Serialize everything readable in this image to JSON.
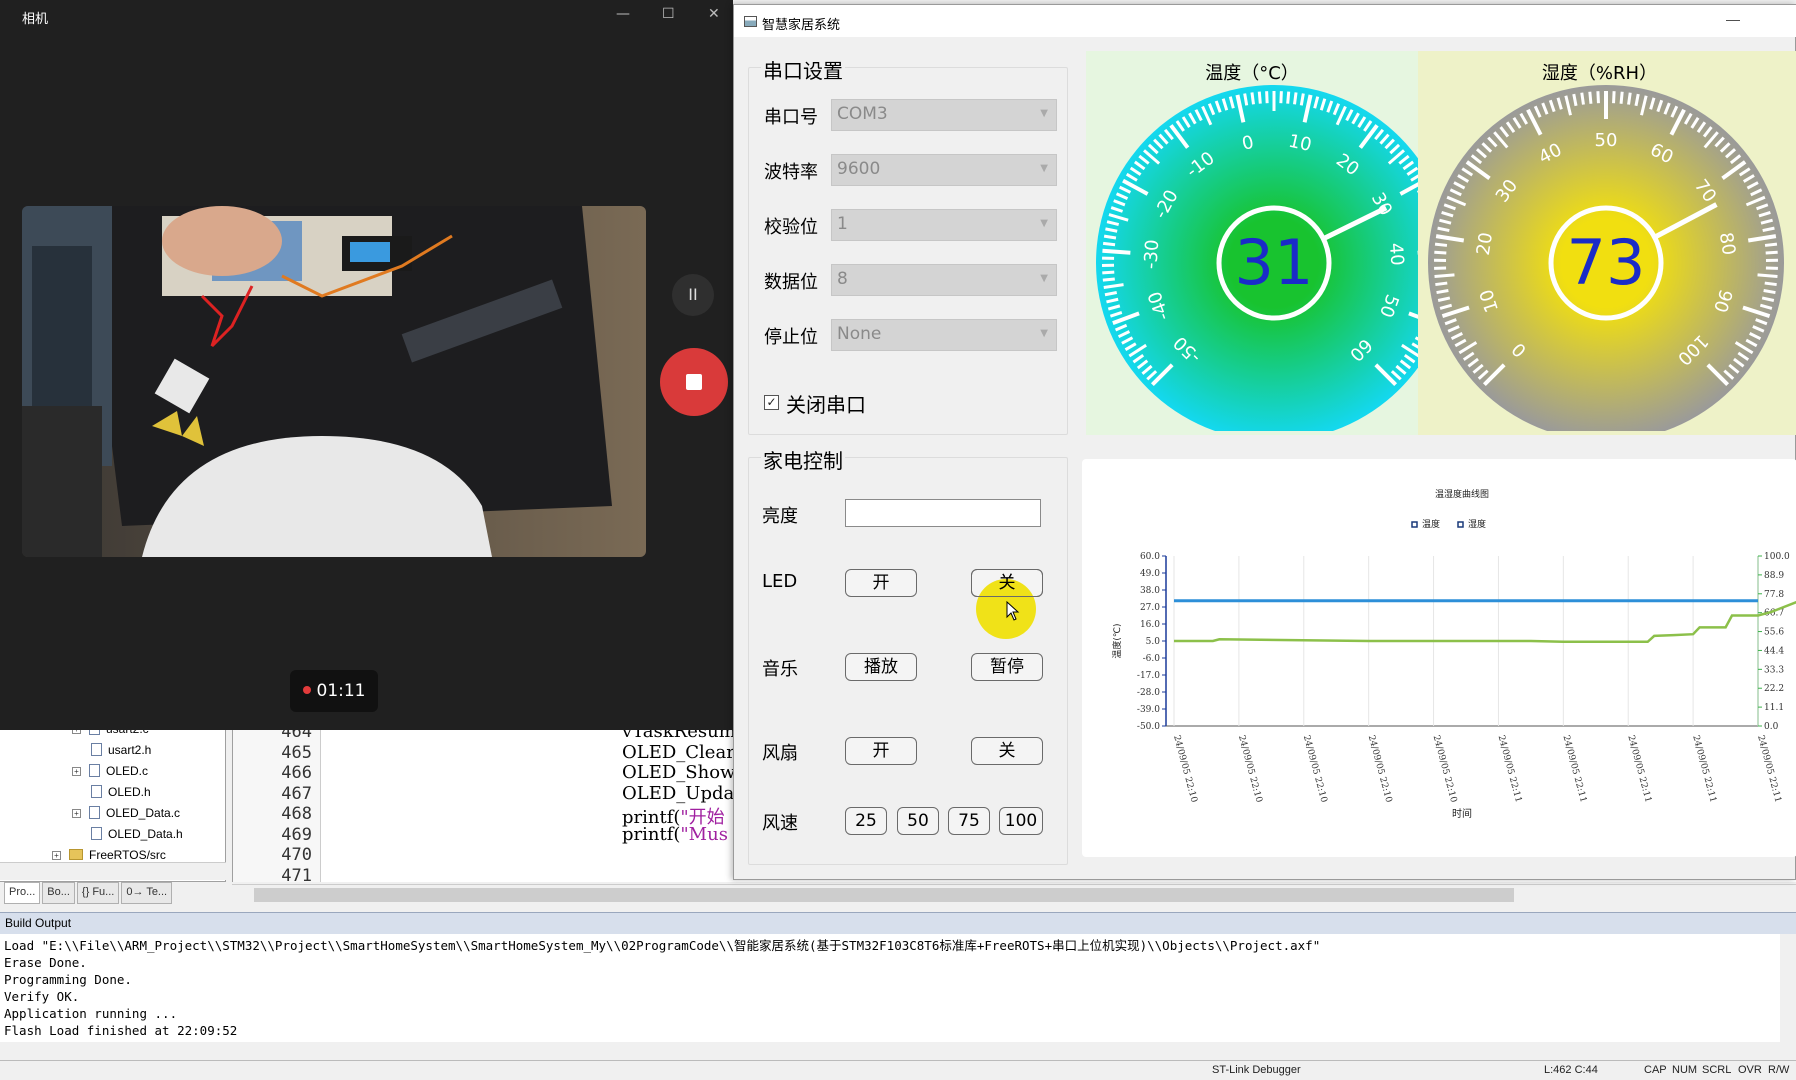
{
  "camera": {
    "title": "相机",
    "timer": "01:11",
    "controls": {
      "minimize": "—",
      "maximize": "☐",
      "close": "✕"
    },
    "pause_symbol": "II"
  },
  "ide": {
    "tree": [
      {
        "label": "usart2.c",
        "expandable": true
      },
      {
        "label": "usart2.h",
        "expandable": false
      },
      {
        "label": "OLED.c",
        "expandable": true
      },
      {
        "label": "OLED.h",
        "expandable": false
      },
      {
        "label": "OLED_Data.c",
        "expandable": true
      },
      {
        "label": "OLED_Data.h",
        "expandable": false
      },
      {
        "label": "FreeRTOS/src",
        "expandable": true,
        "folder": true
      }
    ],
    "proj_tabs": [
      "Pro...",
      "Bo...",
      "{} Fu...",
      "0→ Te..."
    ],
    "line_numbers": [
      "464",
      "465",
      "466",
      "467",
      "468",
      "469",
      "470",
      "471"
    ],
    "code_lines": [
      {
        "text": "vTaskResume"
      },
      {
        "text": "OLED_ClearA"
      },
      {
        "text": "OLED_ShowCh"
      },
      {
        "text": "OLED_Update"
      },
      {
        "text": "printf(",
        "str": "\"开始"
      },
      {
        "text": "printf(",
        "str": "\"Mus"
      }
    ],
    "build_output_title": "Build Output",
    "build_lines": [
      "Load \"E:\\\\File\\\\ARM_Project\\\\STM32\\\\Project\\\\SmartHomeSystem\\\\SmartHomeSystem_My\\\\02ProgramCode\\\\智能家居系统(基于STM32F103C8T6标准库+FreeROTS+串口上位机实现)\\\\Objects\\\\Project.axf\"",
      "Erase Done.",
      "Programming Done.",
      "Verify OK.",
      "Application running ...",
      "Flash Load finished at 22:09:52"
    ],
    "status": {
      "debugger": "ST-Link Debugger",
      "position": "L:462 C:44",
      "cap": "CAP",
      "num": "NUM",
      "scrl": "SCRL",
      "ovr": "OVR",
      "rw": "R/W"
    }
  },
  "smarthome": {
    "title": "智慧家居系统",
    "serial": {
      "group_title": "串口设置",
      "fields": [
        {
          "label": "串口号",
          "value": "COM3"
        },
        {
          "label": "波特率",
          "value": "9600"
        },
        {
          "label": "校验位",
          "value": "1"
        },
        {
          "label": "数据位",
          "value": "8"
        },
        {
          "label": "停止位",
          "value": "None"
        }
      ],
      "close_port_label": "关闭串口",
      "close_port_checked": true
    },
    "appliance": {
      "group_title": "家电控制",
      "brightness_label": "亮度",
      "led_label": "LED",
      "led_on": "开",
      "led_off": "关",
      "music_label": "音乐",
      "music_play": "播放",
      "music_pause": "暂停",
      "fan_label": "风扇",
      "fan_on": "开",
      "fan_off": "关",
      "speed_label": "风速",
      "speeds": [
        "25",
        "50",
        "75",
        "100"
      ]
    },
    "temperature_gauge": {
      "title": "温度（°C）",
      "value": 31,
      "min": -50,
      "max": 60,
      "ticks": [
        "-50",
        "-40",
        "-30",
        "-20",
        "-10",
        "0",
        "10",
        "20",
        "30",
        "40",
        "50",
        "60"
      ],
      "bg": "#e6f6e0",
      "center_color": "#18c32f",
      "outer_color": "#14d8f0",
      "value_color": "#1a2bc8"
    },
    "humidity_gauge": {
      "title": "湿度（%RH）",
      "value": 73,
      "min": 0,
      "max": 100,
      "ticks": [
        "0",
        "10",
        "20",
        "30",
        "40",
        "50",
        "60",
        "70",
        "80",
        "90",
        "100"
      ],
      "bg": "#eef2c8",
      "center_color": "#f1df10",
      "outer_color": "#9a9a9a",
      "value_color": "#1a2bc8"
    },
    "chart_data": {
      "type": "line",
      "title": "温湿度曲线图",
      "xlabel": "时间",
      "ylabel": "温度(℃)",
      "x": [
        "24/09/05 22:10",
        "24/09/05 22:10",
        "24/09/05 22:10",
        "24/09/05 22:10",
        "24/09/05 22:10",
        "24/09/05 22:11",
        "24/09/05 22:11",
        "24/09/05 22:11",
        "24/09/05 22:11",
        "24/09/05 22:11"
      ],
      "y_left_ticks": [
        "60.0",
        "49.0",
        "38.0",
        "27.0",
        "16.0",
        "5.0",
        "-6.0",
        "-17.0",
        "-28.0",
        "-39.0",
        "-50.0"
      ],
      "y_right_ticks": [
        "100.0",
        "88.9",
        "77.8",
        "66.7",
        "55.6",
        "44.4",
        "33.3",
        "22.2",
        "11.1",
        "0.0"
      ],
      "ylim_left": [
        -50,
        60
      ],
      "ylim_right": [
        0,
        100
      ],
      "legend_position": "top",
      "series": [
        {
          "name": "温度",
          "axis": "left",
          "color": "#2d8fd8",
          "points": [
            [
              0,
              31
            ],
            [
              1,
              31
            ],
            [
              2,
              31
            ],
            [
              3,
              31
            ],
            [
              4,
              31
            ],
            [
              5,
              31
            ],
            [
              6,
              31
            ],
            [
              7,
              31
            ],
            [
              8,
              31
            ],
            [
              9,
              31
            ]
          ]
        },
        {
          "name": "湿度",
          "axis": "right",
          "color": "#8cc04a",
          "points": [
            [
              0,
              50
            ],
            [
              0.6,
              50
            ],
            [
              0.7,
              51
            ],
            [
              3,
              50
            ],
            [
              5.5,
              50
            ],
            [
              6,
              49.5
            ],
            [
              7.3,
              49.5
            ],
            [
              7.4,
              53
            ],
            [
              7.7,
              53.5
            ],
            [
              8,
              54
            ],
            [
              8.1,
              58
            ],
            [
              8.5,
              58
            ],
            [
              8.6,
              65
            ],
            [
              9,
              65
            ],
            [
              9.2,
              67
            ],
            [
              9.6,
              73
            ]
          ]
        }
      ]
    }
  }
}
